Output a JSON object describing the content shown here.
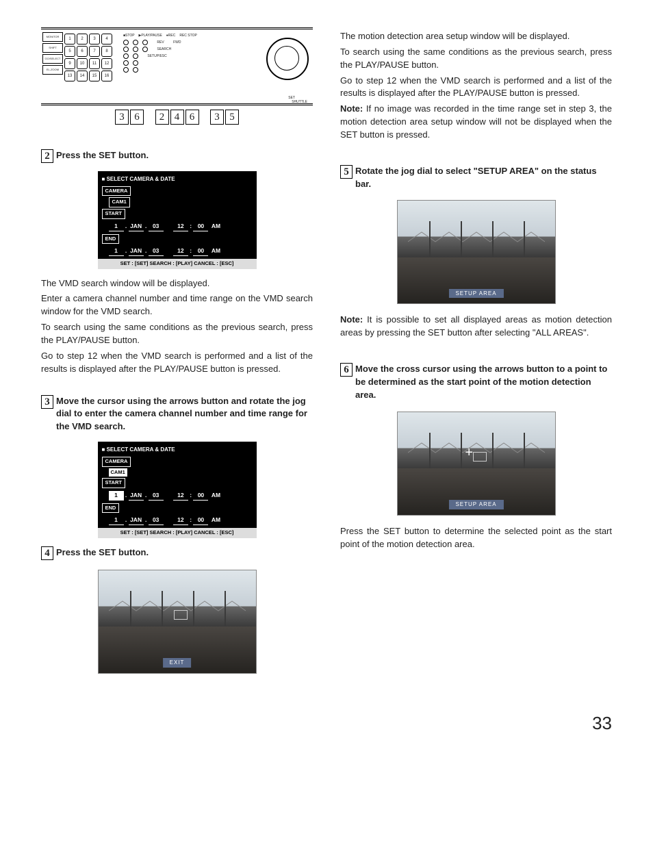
{
  "page_number": "33",
  "device_panel": {
    "cam_buttons": [
      "1",
      "2",
      "3",
      "4",
      "5",
      "6",
      "7",
      "8",
      "9",
      "10",
      "11",
      "12",
      "13",
      "14",
      "15",
      "16"
    ],
    "left_buttons": [
      "MONITOR",
      "SHIFT",
      "GO/SELECT",
      "EL-ZOOM"
    ],
    "top_labels": [
      "■STOP",
      "▶PLAY/PAUSE",
      "●REC",
      "REC STOP"
    ],
    "mid_labels": [
      "REV",
      "FWD",
      "SEARCH",
      "SETUP/ESC",
      "SET",
      "SHUTTLE"
    ],
    "callout_groups": [
      [
        "3",
        "6"
      ],
      [
        "2",
        "4",
        "6"
      ],
      [
        "3",
        "5"
      ]
    ]
  },
  "left_column": {
    "step2": {
      "num": "2",
      "head": "Press the SET button.",
      "screen": {
        "title": "SELECT CAMERA & DATE",
        "camera_label": "CAMERA",
        "cam_value": "CAM1",
        "start_label": "START",
        "start_date": {
          "d": "1",
          "m": "JAN",
          "y": "03",
          "h": "12",
          "min": "00",
          "ap": "AM"
        },
        "end_label": "END",
        "end_date": {
          "d": "1",
          "m": "JAN",
          "y": "03",
          "h": "12",
          "min": "00",
          "ap": "AM"
        },
        "actions": "SET : [SET]   SEARCH : [PLAY]   CANCEL : [ESC]"
      },
      "para1": "The VMD search window will be displayed.",
      "para2": "Enter a camera channel number and time range on the VMD search window for the VMD search.",
      "para3": "To search using the same conditions as the previous search, press the PLAY/PAUSE button.",
      "para4": "Go to step 12 when the VMD search is performed and a list of the results is displayed after the PLAY/PAUSE button is pressed."
    },
    "step3": {
      "num": "3",
      "head": "Move the cursor using the arrows button and rotate the jog dial to enter the camera channel number and time range for the VMD search."
    },
    "step4": {
      "num": "4",
      "head": "Press the SET button.",
      "photo_tag": "EXIT"
    }
  },
  "right_column": {
    "intro": {
      "p1": "The motion detection area setup window will be displayed.",
      "p2": "To search using the same conditions as the previous search, press the PLAY/PAUSE button.",
      "p3": "Go to step 12 when the VMD search is performed and a list of the results is displayed after the PLAY/PAUSE button is pressed.",
      "note_label": "Note:",
      "note": "If no image was recorded in the time range set in step 3, the motion detection area setup window will not be displayed when the SET button is pressed."
    },
    "step5": {
      "num": "5",
      "head": "Rotate the jog dial to select \"SETUP AREA\" on the status bar.",
      "photo_tag": "SETUP AREA",
      "note_label": "Note:",
      "note": "It is possible to set all displayed areas as motion detection areas by pressing the SET button after selecting \"ALL AREAS\"."
    },
    "step6": {
      "num": "6",
      "head": "Move the cross cursor using the arrows button to a point to be determined as the start point of the motion detection area.",
      "photo_tag": "SETUP AREA",
      "p1": "Press the SET button to determine the selected point as the start point of the motion detection area."
    }
  }
}
